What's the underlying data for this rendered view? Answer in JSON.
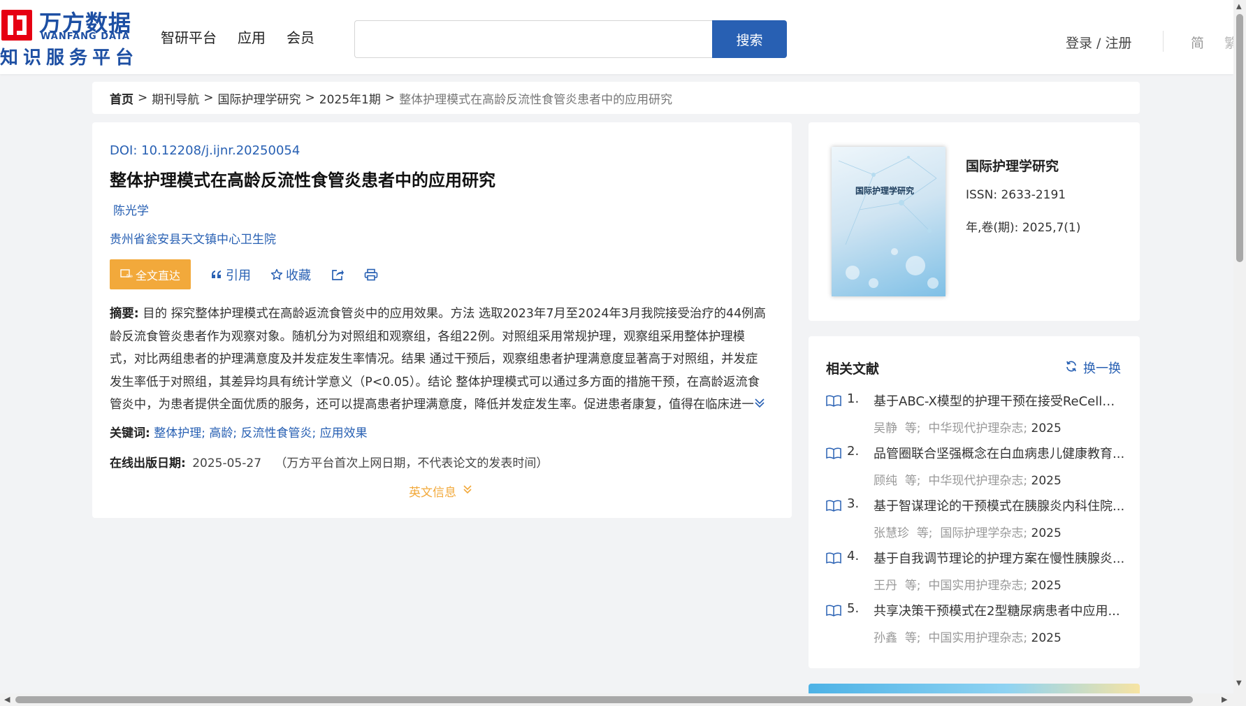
{
  "header": {
    "logo": {
      "cn": "万方数据",
      "en": "WANFANG DATA",
      "sub": "知识服务平台"
    },
    "nav": [
      "智研平台",
      "应用",
      "会员"
    ],
    "search": {
      "value": "",
      "placeholder": "",
      "button": "搜索"
    },
    "login": "登录 / 注册",
    "lang": "简",
    "lang2": "繁"
  },
  "breadcrumb": {
    "home": "首页",
    "items": [
      "期刊导航",
      "国际护理学研究",
      "2025年1期"
    ],
    "current": "整体护理模式在高龄反流性食管炎患者中的应用研究",
    "sep": ">"
  },
  "article": {
    "doi_label": "DOI:",
    "doi": "10.12208/j.ijnr.20250054",
    "title": "整体护理模式在高龄反流性食管炎患者中的应用研究",
    "author": "陈光学",
    "org": "贵州省瓮安县天文镇中心卫生院",
    "actions": {
      "fulltext": "全文直达",
      "cite": "引用",
      "collect": "收藏"
    },
    "abstract_label": "摘要:",
    "abstract": "目的 探究整体护理模式在高龄返流食管炎中的应用效果。方法 选取2023年7月至2024年3月我院接受治疗的44例高龄反流食管炎患者作为观察对象。随机分为对照组和观察组，各组22例。对照组采用常规护理，观察组采用整体护理模式，对比两组患者的护理满意度及并发症发生率情况。结果 通过干预后，观察组患者护理满意度显著高于对照组，并发症发生率低于对照组，其差异均具有统计学意义（P<0.05）。结论 整体护理模式可以通过多方面的措施干预，在高龄返流食管炎中，为患者提供全面优质的服务，还可以提高患者护理满意度，降低并发症发生率。促进患者康复，值得在临床进一步...",
    "keywords_label": "关键词:",
    "keywords": [
      "整体护理",
      "高龄",
      "反流性食管炎",
      "应用效果"
    ],
    "pubdate_label": "在线出版日期:",
    "pubdate": "2025-05-27",
    "pubdate_note": "（万方平台首次上网日期，不代表论文的发表时间）",
    "en_info": "英文信息"
  },
  "journal": {
    "name": "国际护理学研究",
    "cover_title": "国际护理学研究",
    "issn_label": "ISSN:",
    "issn": "2633-2191",
    "vol_label": "年,卷(期):",
    "vol": "2025,7(1)"
  },
  "related": {
    "title": "相关文献",
    "refresh": "换一换",
    "items": [
      {
        "num": "1.",
        "title": "基于ABC-X模型的护理干预在接受ReCell技...",
        "author": "吴静",
        "etal": "等;",
        "journal": "中华现代护理杂志",
        "year": "2025"
      },
      {
        "num": "2.",
        "title": "品管圈联合坚强概念在白血病患儿健康教育...",
        "author": "顾纯",
        "etal": "等;",
        "journal": "中华现代护理杂志",
        "year": "2025"
      },
      {
        "num": "3.",
        "title": "基于智谋理论的干预模式在胰腺炎内科住院...",
        "author": "张慧珍",
        "etal": "等;",
        "journal": "国际护理学杂志",
        "year": "2025"
      },
      {
        "num": "4.",
        "title": "基于自我调节理论的护理方案在慢性胰腺炎...",
        "author": "王丹",
        "etal": "等;",
        "journal": "中国实用护理杂志",
        "year": "2025"
      },
      {
        "num": "5.",
        "title": "共享决策干预模式在2型糖尿病患者中应用...",
        "author": "孙鑫",
        "etal": "等;",
        "journal": "中国实用护理杂志",
        "year": "2025"
      }
    ]
  },
  "colors": {
    "brand_blue": "#2860b3",
    "accent_orange": "#f2a93b",
    "logo_red": "#e60012"
  }
}
